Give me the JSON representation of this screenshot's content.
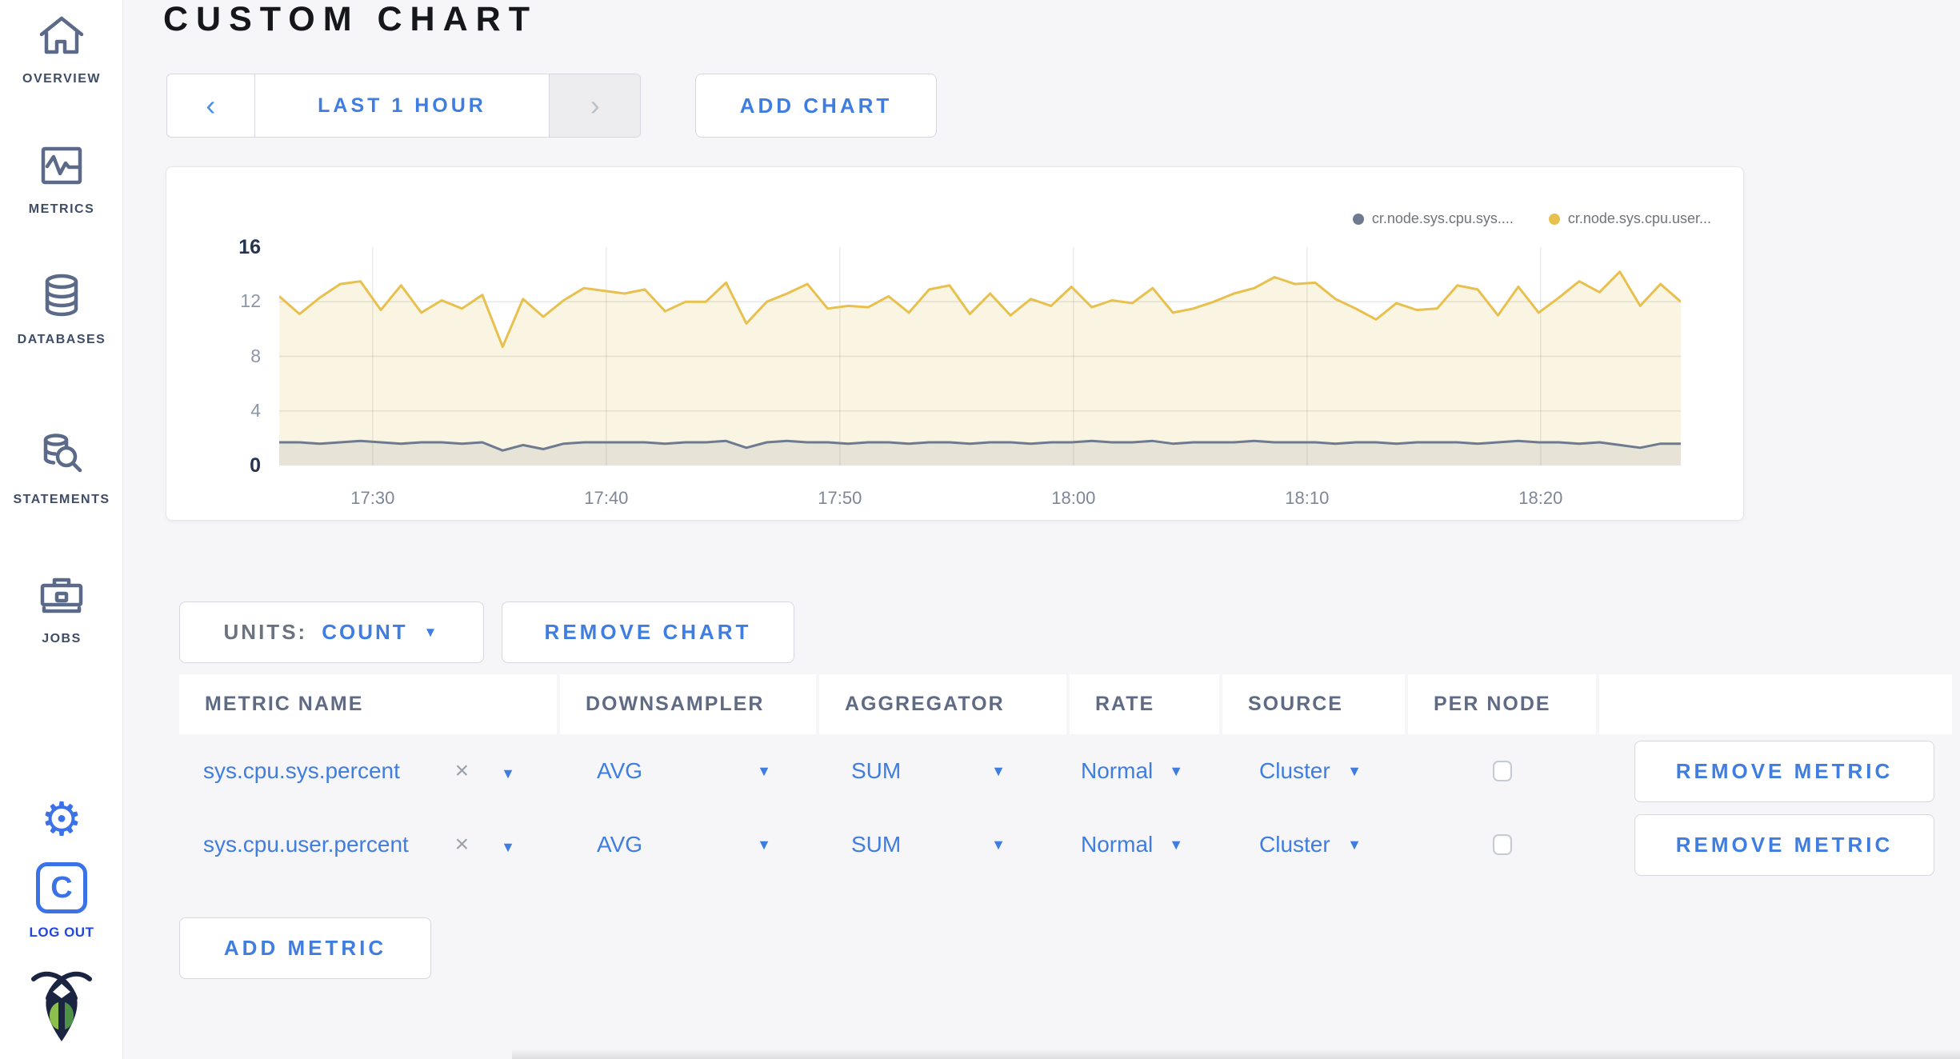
{
  "sidebar": {
    "items": [
      {
        "label": "OVERVIEW"
      },
      {
        "label": "METRICS"
      },
      {
        "label": "DATABASES"
      },
      {
        "label": "STATEMENTS"
      },
      {
        "label": "JOBS"
      }
    ],
    "logout_label": "LOG OUT",
    "clogo_letter": "C"
  },
  "header": {
    "title": "CUSTOM CHART"
  },
  "toolbar": {
    "time_range_label": "LAST 1 HOUR",
    "add_chart_label": "ADD CHART"
  },
  "icons": {
    "chevron_left": "‹",
    "chevron_right": "›",
    "caret_down": "▼",
    "clear": "×",
    "gear": "⚙"
  },
  "chart_card": {
    "legend": [
      {
        "label": "cr.node.sys.cpu.sys....",
        "color": "#6d7a90"
      },
      {
        "label": "cr.node.sys.cpu.user...",
        "color": "#e8c04e"
      }
    ]
  },
  "chart_data": {
    "type": "line",
    "title": "",
    "xlabel": "",
    "ylabel": "",
    "ylim": [
      0,
      16
    ],
    "y_ticks": [
      0,
      4,
      8,
      12,
      16
    ],
    "x_ticks": [
      "17:30",
      "17:40",
      "17:50",
      "18:00",
      "18:10",
      "18:20"
    ],
    "x_tick_offsets_min": [
      4,
      14,
      24,
      34,
      44,
      54
    ],
    "x_span_min": 60,
    "grid": true,
    "legend_position": "top-right",
    "series": [
      {
        "name": "cr.node.sys.cpu.user...",
        "color": "#e8c04e",
        "fill": "#faf4e2",
        "values": [
          12.4,
          11.1,
          12.3,
          13.3,
          13.5,
          11.4,
          13.2,
          11.2,
          12.1,
          11.5,
          12.5,
          8.7,
          12.2,
          10.9,
          12.1,
          13.0,
          12.8,
          12.6,
          12.9,
          11.3,
          12.0,
          12.0,
          13.4,
          10.4,
          12.0,
          12.6,
          13.3,
          11.5,
          11.7,
          11.6,
          12.4,
          11.2,
          12.9,
          13.2,
          11.1,
          12.6,
          11.0,
          12.2,
          11.7,
          13.1,
          11.6,
          12.1,
          11.9,
          13.0,
          11.2,
          11.5,
          12.0,
          12.6,
          13.0,
          13.8,
          13.3,
          13.4,
          12.2,
          11.5,
          10.7,
          11.9,
          11.4,
          11.5,
          13.2,
          12.9,
          11.0,
          13.1,
          11.2,
          12.3,
          13.5,
          12.7,
          14.2,
          11.7,
          13.3,
          12.0
        ]
      },
      {
        "name": "cr.node.sys.cpu.sys....",
        "color": "#6d7a90",
        "fill": "rgba(109,122,144,0.13)",
        "values": [
          1.7,
          1.7,
          1.6,
          1.7,
          1.8,
          1.7,
          1.6,
          1.7,
          1.7,
          1.6,
          1.7,
          1.1,
          1.5,
          1.2,
          1.6,
          1.7,
          1.7,
          1.7,
          1.7,
          1.6,
          1.7,
          1.7,
          1.8,
          1.3,
          1.7,
          1.8,
          1.7,
          1.7,
          1.6,
          1.7,
          1.7,
          1.6,
          1.7,
          1.7,
          1.6,
          1.7,
          1.7,
          1.6,
          1.7,
          1.7,
          1.8,
          1.7,
          1.7,
          1.8,
          1.6,
          1.7,
          1.7,
          1.7,
          1.8,
          1.7,
          1.7,
          1.7,
          1.6,
          1.7,
          1.7,
          1.6,
          1.7,
          1.7,
          1.7,
          1.6,
          1.7,
          1.8,
          1.7,
          1.7,
          1.6,
          1.7,
          1.5,
          1.3,
          1.6,
          1.6
        ]
      }
    ]
  },
  "units_bar": {
    "units_label": "UNITS:",
    "units_value": "COUNT",
    "remove_chart_label": "REMOVE CHART"
  },
  "table": {
    "headers": [
      "METRIC NAME",
      "DOWNSAMPLER",
      "AGGREGATOR",
      "RATE",
      "SOURCE",
      "PER NODE",
      ""
    ],
    "rows": [
      {
        "metric": "sys.cpu.sys.percent",
        "downsampler": "AVG",
        "aggregator": "SUM",
        "rate": "Normal",
        "source": "Cluster",
        "per_node_checked": false,
        "remove_label": "REMOVE METRIC"
      },
      {
        "metric": "sys.cpu.user.percent",
        "downsampler": "AVG",
        "aggregator": "SUM",
        "rate": "Normal",
        "source": "Cluster",
        "per_node_checked": false,
        "remove_label": "REMOVE METRIC"
      }
    ]
  },
  "add_metric_label": "ADD METRIC"
}
